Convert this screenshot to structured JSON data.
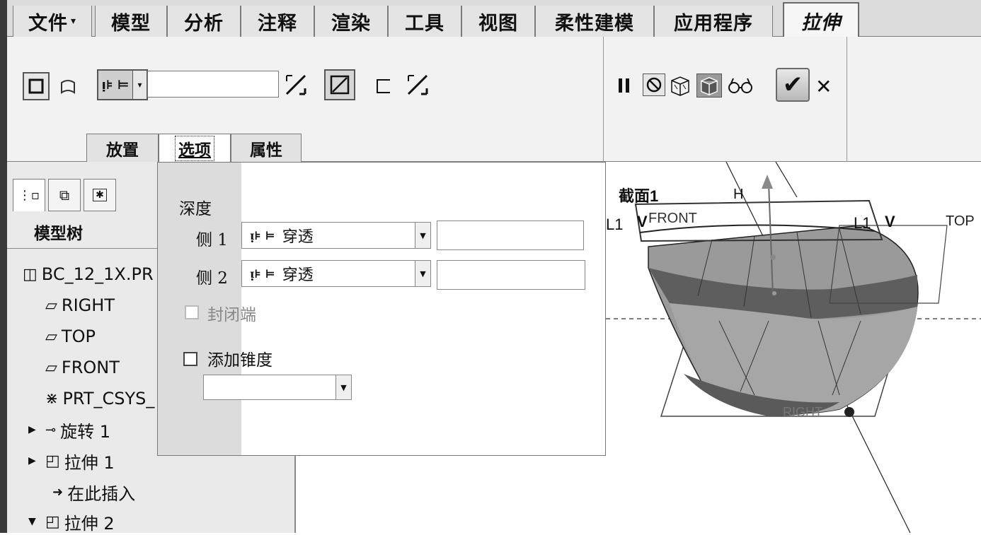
{
  "tabs": [
    {
      "label": "文件",
      "has_caret": true
    },
    {
      "label": "模型"
    },
    {
      "label": "分析"
    },
    {
      "label": "注释"
    },
    {
      "label": "渲染"
    },
    {
      "label": "工具"
    },
    {
      "label": "视图"
    },
    {
      "label": "柔性建模"
    },
    {
      "label": "应用程序"
    },
    {
      "label": "拉伸",
      "active": true
    }
  ],
  "ribbon": {
    "depth_value": "",
    "subtabs": [
      {
        "label": "放置"
      },
      {
        "label": "选项",
        "active": true
      },
      {
        "label": "属性"
      }
    ],
    "ok_symbol": "✔",
    "cancel_symbol": "✕"
  },
  "model_tree": {
    "title": "模型树",
    "items": [
      {
        "label": "BC_12_1X.PR",
        "icon": "part-icon"
      },
      {
        "label": "RIGHT",
        "icon": "datum-plane-icon"
      },
      {
        "label": "TOP",
        "icon": "datum-plane-icon"
      },
      {
        "label": "FRONT",
        "icon": "datum-plane-icon"
      },
      {
        "label": "PRT_CSYS_",
        "icon": "csys-icon"
      },
      {
        "label": "旋转 1",
        "icon": "revolve-icon",
        "expander": "collapsed"
      },
      {
        "label": "拉伸 1",
        "icon": "extrude-icon",
        "expander": "collapsed"
      },
      {
        "label": "在此插入",
        "icon": "insert-arrow-icon"
      },
      {
        "label": "拉伸 2",
        "icon": "extrude-icon",
        "expander": "expanded"
      }
    ]
  },
  "options_panel": {
    "depth_label": "深度",
    "side1_label": "侧 1",
    "side1_value": "穿透",
    "side2_label": "侧 2",
    "side2_value": "穿透",
    "capped_ends_label": "封闭端",
    "add_taper_label": "添加锥度",
    "add_taper_checked": false,
    "capped_ends_enabled": false
  },
  "graphics": {
    "labels": {
      "section": "截面1",
      "h": "H",
      "front": "FRONT",
      "top": "TOP",
      "l1_left": "L1",
      "v_left": "V",
      "l1_right": "L1",
      "v_right": "V",
      "right": "RIGHT"
    }
  }
}
